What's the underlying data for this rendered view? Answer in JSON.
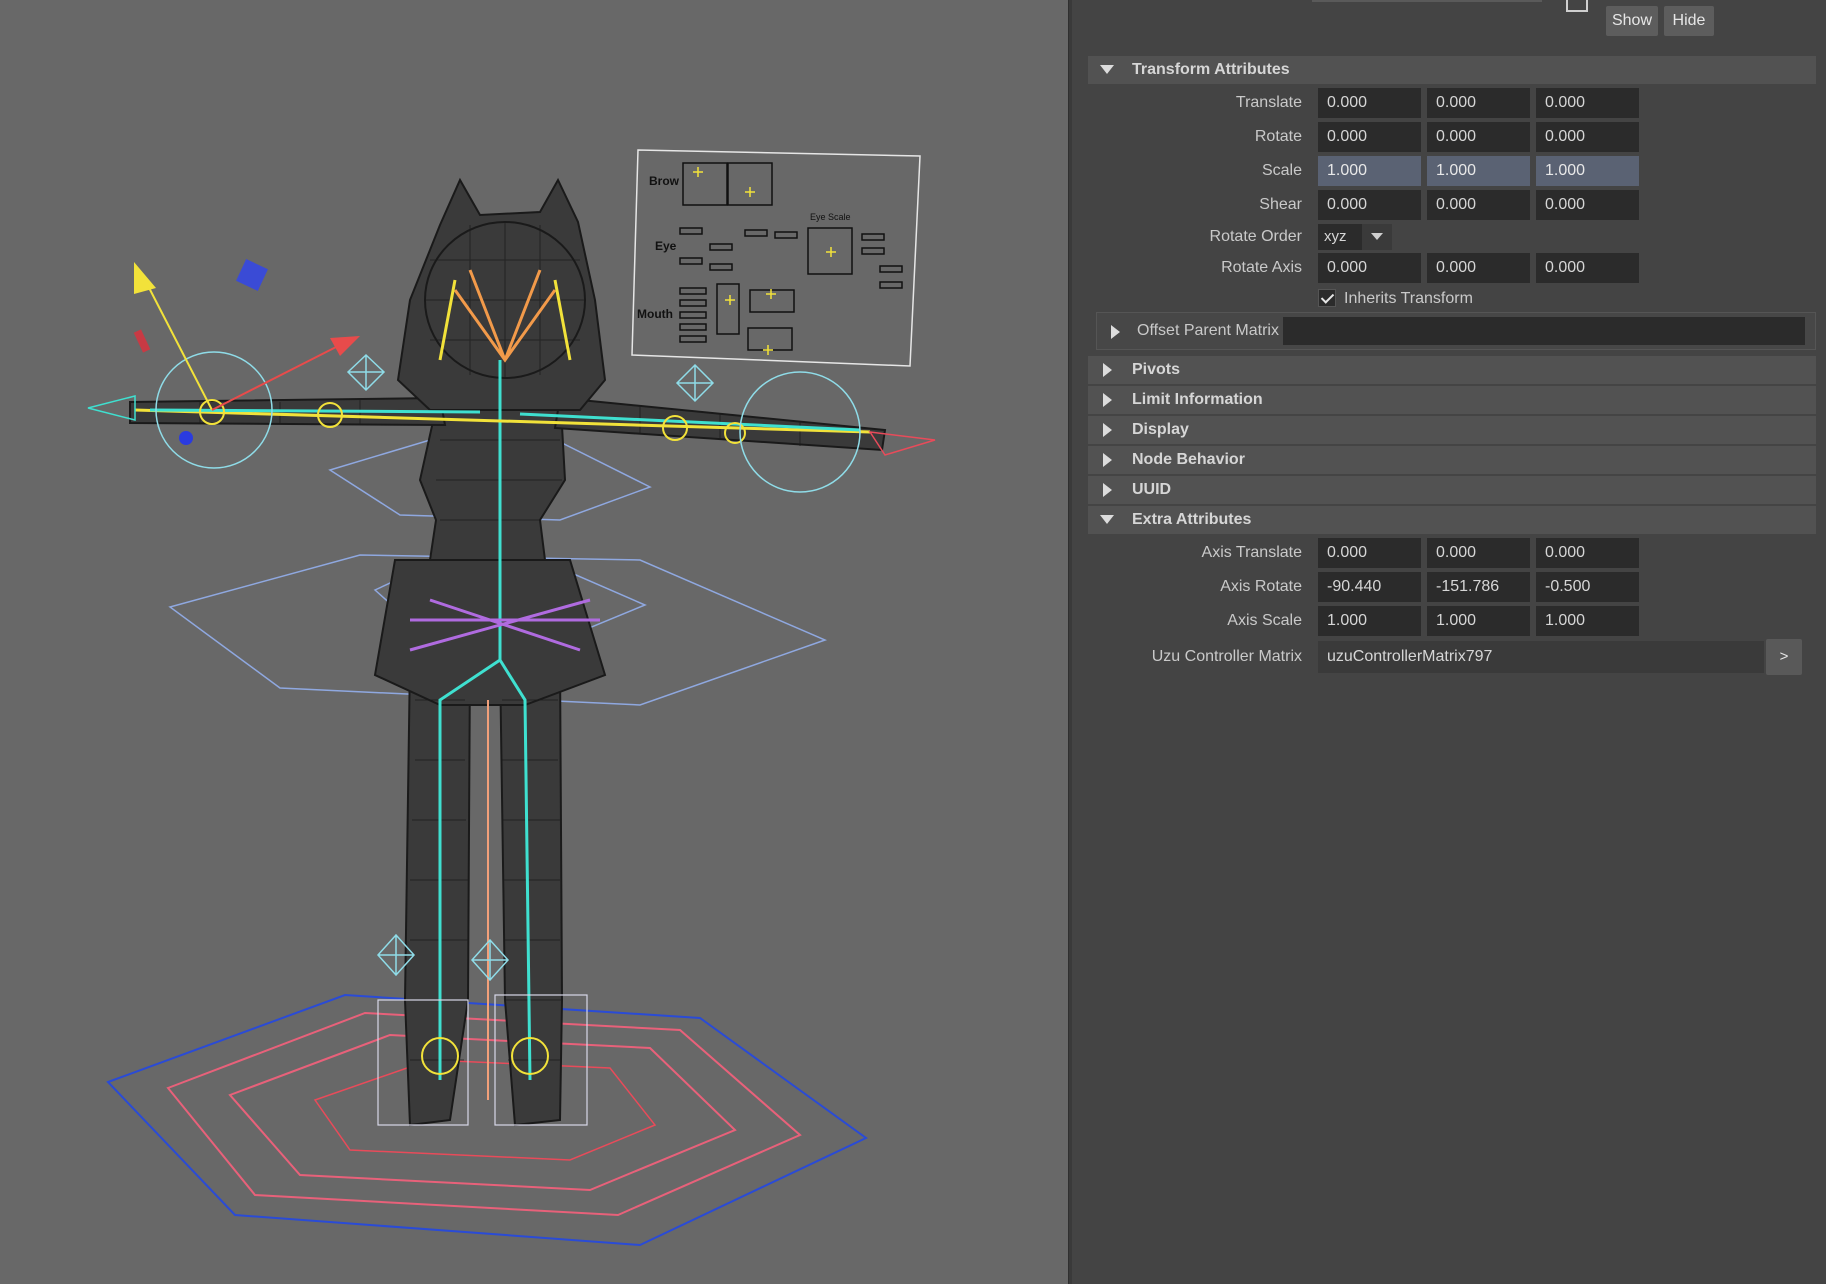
{
  "header": {
    "show_label": "Show",
    "hide_label": "Hide"
  },
  "transform": {
    "title": "Transform Attributes",
    "translate": {
      "label": "Translate",
      "values": [
        "0.000",
        "0.000",
        "0.000"
      ]
    },
    "rotate": {
      "label": "Rotate",
      "values": [
        "0.000",
        "0.000",
        "0.000"
      ]
    },
    "scale": {
      "label": "Scale",
      "values": [
        "1.000",
        "1.000",
        "1.000"
      ]
    },
    "shear": {
      "label": "Shear",
      "values": [
        "0.000",
        "0.000",
        "0.000"
      ]
    },
    "rotate_order": {
      "label": "Rotate Order",
      "value": "xyz"
    },
    "rotate_axis": {
      "label": "Rotate Axis",
      "values": [
        "0.000",
        "0.000",
        "0.000"
      ]
    },
    "inherits_transform": {
      "label": "Inherits Transform",
      "checked": true
    },
    "offset_parent_matrix": {
      "label": "Offset Parent Matrix"
    }
  },
  "sections": {
    "pivots": "Pivots",
    "limit_information": "Limit Information",
    "display": "Display",
    "node_behavior": "Node Behavior",
    "uuid": "UUID"
  },
  "extra": {
    "title": "Extra Attributes",
    "axis_translate": {
      "label": "Axis Translate",
      "values": [
        "0.000",
        "0.000",
        "0.000"
      ]
    },
    "axis_rotate": {
      "label": "Axis Rotate",
      "values": [
        "-90.440",
        "-151.786",
        "-0.500"
      ]
    },
    "axis_scale": {
      "label": "Axis Scale",
      "values": [
        "1.000",
        "1.000",
        "1.000"
      ]
    },
    "uzu_controller_matrix": {
      "label": "Uzu Controller Matrix",
      "value": "uzuControllerMatrix797",
      "button": ">"
    }
  },
  "face_panel": {
    "brow": "Brow",
    "eye": "Eye",
    "mouth": "Mouth",
    "eye_scale": "Eye Scale"
  },
  "colors": {
    "viewport_bg": "#686868",
    "panel_bg": "#444444",
    "field_bg": "#2b2b2b",
    "highlight_field": "#5a6273",
    "wireframe": "#1a1a1a",
    "joint_cyan": "#3fe0d0",
    "joint_yellow": "#f2e23a",
    "control_red": "#e84b5a",
    "control_blue": "#2a4bd6"
  }
}
